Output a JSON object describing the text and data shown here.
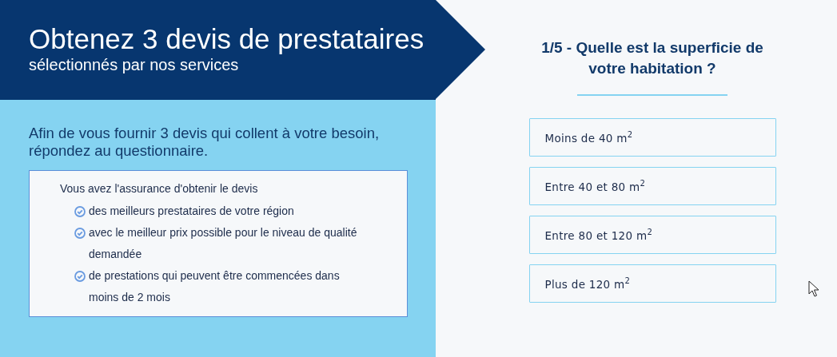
{
  "header": {
    "title": "Obtenez 3 devis de prestataires",
    "subtitle": "sélectionnés par nos services"
  },
  "intro": "Afin de vous fournir 3 devis qui collent à votre besoin, répondez au questionnaire.",
  "assurance": {
    "lead": "Vous avez l'assurance d'obtenir le devis",
    "points": [
      "des meilleurs prestataires de votre région",
      "avec le meilleur prix possible pour le niveau de qualité demandée",
      "de prestations qui peuvent être commencées dans moins de 2 mois"
    ]
  },
  "question": {
    "title": "1/5 - Quelle est la superficie de votre habitation ?",
    "options": [
      {
        "label": "Moins de 40 m$^{2}$",
        "selected": false
      },
      {
        "label": "Entre 40 et 80 m$^{2}$",
        "selected": false
      },
      {
        "label": "Entre 80 et 120 m$^{2}$",
        "selected": false
      },
      {
        "label": "Plus de 120 m$^{2}$",
        "selected": false
      }
    ]
  }
}
